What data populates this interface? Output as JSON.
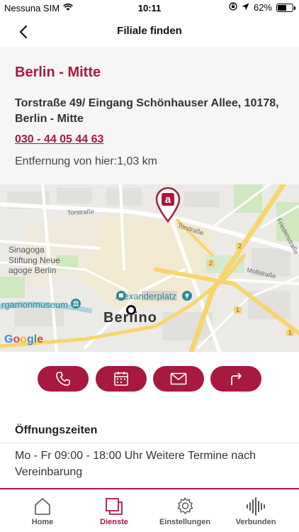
{
  "status_bar": {
    "carrier": "Nessuna SIM",
    "time": "10:11",
    "battery": "62%",
    "battery_level": 0.62
  },
  "nav": {
    "title": "Filiale finden"
  },
  "branch": {
    "name": "Berlin - Mitte",
    "address": "Torstraße 49/ Eingang Schönhauser Allee, 10178, Berlin - Mitte",
    "phone": "030 - 44 05 44 63",
    "distance": "Entfernung von hier:1,03 km"
  },
  "map": {
    "labels": {
      "torstrasse_1": "Torstraße",
      "torstrasse_2": "Torstraße",
      "friedenstrasse": "Friedenstraße",
      "mollstrasse": "Mollstraße",
      "synagoga": "Sinagoga",
      "stiftung_1": "Stiftung Neue",
      "stiftung_2": "agoge Berlin",
      "museum": "rgamonmuseum",
      "alexanderplatz": "Alexanderplatz",
      "city": "Berlino",
      "route_2a": "2",
      "route_2b": "2",
      "route_1a": "1",
      "route_1b": "1",
      "google": [
        "G",
        "o",
        "o",
        "g",
        "l",
        "e"
      ]
    },
    "accent": "#a8193f"
  },
  "actions": [
    "phone-icon",
    "calendar-icon",
    "mail-icon",
    "directions-icon"
  ],
  "hours": {
    "title": "Öffnungszeiten",
    "text": "Mo - Fr 09:00 - 18:00 Uhr Weitere Termine nach Vereinbarung"
  },
  "tabs": [
    {
      "label": "Home",
      "icon": "home-icon"
    },
    {
      "label": "Dienste",
      "icon": "services-icon"
    },
    {
      "label": "Einstellungen",
      "icon": "gear-icon"
    },
    {
      "label": "Verbunden",
      "icon": "sound-wave-icon"
    }
  ],
  "colors": {
    "accent": "#a8193f",
    "background": "#f6f6f6"
  }
}
